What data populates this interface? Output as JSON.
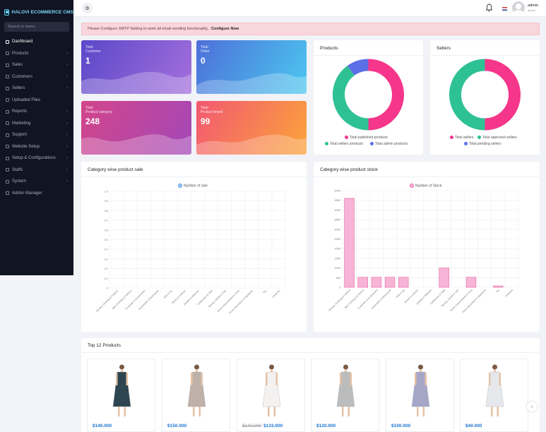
{
  "app": {
    "logo_text": "HALOVI ECOMMERCE CMS"
  },
  "sidebar": {
    "search_placeholder": "Search in menu",
    "items": [
      {
        "label": "Dashboard",
        "icon": "home-icon",
        "chevron": false,
        "active": true
      },
      {
        "label": "Products",
        "icon": "box-icon",
        "chevron": true
      },
      {
        "label": "Sales",
        "icon": "sales-icon",
        "chevron": true
      },
      {
        "label": "Customers",
        "icon": "users-icon",
        "chevron": true
      },
      {
        "label": "Sellers",
        "icon": "user-icon",
        "chevron": true
      },
      {
        "label": "Uploaded Files",
        "icon": "upload-icon",
        "chevron": false
      },
      {
        "label": "Reports",
        "icon": "report-icon",
        "chevron": true
      },
      {
        "label": "Marketing",
        "icon": "megaphone-icon",
        "chevron": true
      },
      {
        "label": "Support",
        "icon": "support-icon",
        "chevron": true
      },
      {
        "label": "Website Setup",
        "icon": "desktop-icon",
        "chevron": true
      },
      {
        "label": "Setup & Configurations",
        "icon": "gear-icon",
        "chevron": true
      },
      {
        "label": "Staffs",
        "icon": "staff-icon",
        "chevron": true
      },
      {
        "label": "System",
        "icon": "system-icon",
        "chevron": true
      },
      {
        "label": "Addon Manager",
        "icon": "wrench-icon",
        "chevron": false
      }
    ]
  },
  "topbar": {
    "user_name": "admin",
    "user_role": "admin"
  },
  "alert": {
    "message": "Please Configure SMTP Setting to work all email sending functionality,",
    "link": "Configure Now"
  },
  "stats": [
    {
      "line1": "Total",
      "line2": "Customer",
      "value": "1",
      "gradient": [
        "#5a48c9",
        "#a56fdc"
      ]
    },
    {
      "line1": "Total",
      "line2": "Order",
      "value": "0",
      "gradient": [
        "#4d6fd9",
        "#4cc8ef"
      ]
    },
    {
      "line1": "Total",
      "line2": "Product category",
      "value": "248",
      "gradient": [
        "#d3458a",
        "#a348b8"
      ]
    },
    {
      "line1": "Total",
      "line2": "Product brand",
      "value": "99",
      "gradient": [
        "#f25872",
        "#fba43a"
      ]
    }
  ],
  "products_donut": {
    "title": "Products",
    "legend": [
      "Total published products",
      "Total sellers products",
      "Total admin products"
    ],
    "colors": [
      "#f5368a",
      "#2ec194",
      "#5b6fe6"
    ],
    "values": [
      50,
      40,
      10
    ]
  },
  "sellers_donut": {
    "title": "Sellers",
    "legend": [
      "Total sellers",
      "Total approved sellers",
      "Total pending sellers"
    ],
    "colors": [
      "#f5368a",
      "#2ec194",
      "#5b6fe6"
    ],
    "values": [
      50,
      50,
      0
    ]
  },
  "chart_data": [
    {
      "type": "bar",
      "title": "Category wise product sale",
      "series": [
        {
          "name": "Number of sale",
          "values": [
            0,
            0,
            0,
            0,
            0,
            0,
            0,
            0,
            0,
            0,
            0,
            0,
            0
          ]
        }
      ],
      "categories": [
        "Women Clothing & Fashion",
        "Men Clothing & Fashion",
        "Computer & Accessories",
        "Automobile & Motorcycle",
        "Kids & toy",
        "Sports & outdoor",
        "Jewelry & Watches",
        "Cellphones & Tabs",
        "Beauty, Health & Hair",
        "Home Improvement & Tools",
        "Home decoration & Appliance",
        "Toy",
        "Cameras"
      ],
      "y_ticks": [
        "1.0",
        "0.9",
        "0.8",
        "0.7",
        "0.6",
        "0.5",
        "0.4",
        "0.3",
        "0.2",
        "0.1",
        "0"
      ],
      "ylim": [
        0,
        1
      ],
      "color": "#9cc3f5",
      "stroke": "#5b9ee6"
    },
    {
      "type": "bar",
      "title": "Category wise product stock",
      "series": [
        {
          "name": "Number of Stock",
          "values": [
            4600,
            520,
            520,
            520,
            520,
            0,
            0,
            1000,
            0,
            520,
            0,
            70,
            0
          ]
        }
      ],
      "categories": [
        "Women Clothing & Fashion",
        "Men Clothing & Fashion",
        "Computer & Accessories",
        "Automobile & Motorcycle",
        "Kids & toy",
        "Sports & outdoor",
        "Jewelry & Watches",
        "Cellphones & Tabs",
        "Beauty, Health & Hair",
        "Home Improvement & Tools",
        "Home decoration & Appliance",
        "Toy",
        "Cameras"
      ],
      "y_ticks": [
        "5000",
        "4500",
        "4000",
        "3500",
        "3000",
        "2500",
        "2000",
        "1500",
        "1000",
        "500",
        "0"
      ],
      "ylim": [
        0,
        5000
      ],
      "color": "#f7b4d6",
      "stroke": "#e8609f"
    }
  ],
  "top_products": {
    "title": "Top 12 Products",
    "items": [
      {
        "price": "$140.000",
        "old_price": "",
        "dress": "#2d4451"
      },
      {
        "price": "$150.000",
        "old_price": "",
        "dress": "#bfb1a7"
      },
      {
        "price": "$133.000",
        "old_price": "$140.000",
        "dress": "#f4f2f0"
      },
      {
        "price": "$120.000",
        "old_price": "",
        "dress": "#bcbcbc"
      },
      {
        "price": "$100.000",
        "old_price": "",
        "dress": "#a6a6c8"
      },
      {
        "price": "$40.000",
        "old_price": "",
        "dress": "#e6e8ec"
      }
    ]
  }
}
